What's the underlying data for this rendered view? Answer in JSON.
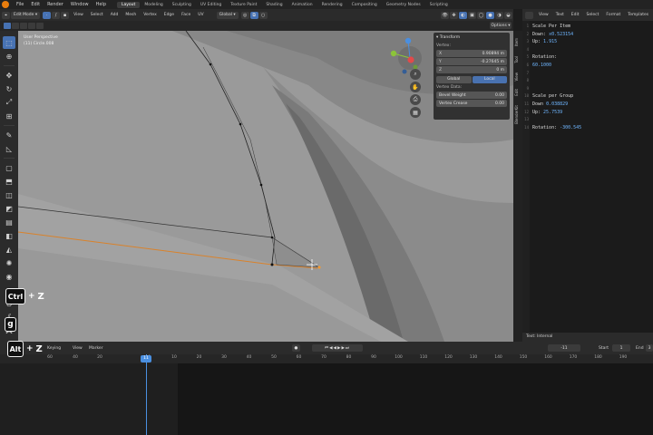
{
  "topbar": {
    "menus": [
      "File",
      "Edit",
      "Render",
      "Window",
      "Help"
    ],
    "workspaces": [
      "Layout",
      "Modeling",
      "Sculpting",
      "UV Editing",
      "Texture Paint",
      "Shading",
      "Animation",
      "Rendering",
      "Compositing",
      "Geometry Nodes",
      "Scripting"
    ],
    "active_workspace": "Layout"
  },
  "viewport_header": {
    "mode": "Edit Mode",
    "menus": [
      "View",
      "Select",
      "Add",
      "Mesh",
      "Vertex",
      "Edge",
      "Face",
      "UV"
    ],
    "orientation": "Global",
    "options_label": "Options"
  },
  "viewport": {
    "perspective": "User Perspective",
    "object": "(11) Circle.008"
  },
  "npanel": {
    "title": "Transform",
    "vertex_label": "Vertex:",
    "x": {
      "label": "X",
      "value": "0.90894 m"
    },
    "y": {
      "label": "Y",
      "value": "-0.27645 m"
    },
    "z": {
      "label": "Z",
      "value": "0 m"
    },
    "global_label": "Global",
    "local_label": "Local",
    "vertex_data_label": "Vertex Data:",
    "bevel_weight": {
      "label": "Bevel Weight",
      "value": "0.00"
    },
    "vertex_crease": {
      "label": "Vertex Crease",
      "value": "0.00"
    }
  },
  "side_tabs": [
    "Item",
    "Tool",
    "View",
    "Edit",
    "BlenderKit"
  ],
  "text_editor": {
    "menus": [
      "View",
      "Text",
      "Edit",
      "Select",
      "Format",
      "Templates"
    ],
    "lines": [
      {
        "n": "1",
        "label": "Scale Per Item",
        "value": ""
      },
      {
        "n": "2",
        "label": "Down:",
        "value": "x0.523154"
      },
      {
        "n": "3",
        "label": "Up:",
        "value": "1.915"
      },
      {
        "n": "4",
        "label": "",
        "value": ""
      },
      {
        "n": "5",
        "label": "Rotation:",
        "value": ""
      },
      {
        "n": "6",
        "label": "",
        "value": "60.1000"
      },
      {
        "n": "7",
        "label": "",
        "value": ""
      },
      {
        "n": "8",
        "label": "",
        "value": ""
      },
      {
        "n": "9",
        "label": "",
        "value": ""
      },
      {
        "n": "10",
        "label": "Scale per Group",
        "value": ""
      },
      {
        "n": "11",
        "label": "Down",
        "value": "0.038829"
      },
      {
        "n": "12",
        "label": "Up:",
        "value": "25.7539"
      },
      {
        "n": "13",
        "label": "",
        "value": ""
      },
      {
        "n": "14",
        "label": "Rotation:",
        "value": "-300.545"
      }
    ],
    "footer": "Text: Internal"
  },
  "timeline": {
    "menus": [
      "Keying",
      "View",
      "Marker"
    ],
    "current_frame": "11",
    "frame_field": "-11",
    "start_label": "Start",
    "start_value": "1",
    "end_label": "End",
    "end_value": "3",
    "ticks": [
      "-60",
      "-40",
      "-20",
      "0",
      "20",
      "40",
      "60",
      "80",
      "100",
      "120",
      "140",
      "160",
      "180",
      "200",
      "220",
      "240",
      "260",
      "280",
      "300",
      "320"
    ],
    "ticks_visible": [
      "60",
      "40",
      "20",
      "11",
      "0",
      "10",
      "20",
      "30",
      "40",
      "50",
      "60",
      "70",
      "80",
      "90",
      "100",
      "110",
      "120",
      "130",
      "140",
      "150",
      "160",
      "170",
      "180",
      "190"
    ]
  },
  "key_overlays": {
    "ctrl_z": {
      "key": "Ctrl",
      "plus": "+",
      "letter": "Z"
    },
    "g": {
      "key": "g"
    },
    "alt_z": {
      "key": "Alt",
      "plus": "+",
      "letter": "Z"
    }
  }
}
